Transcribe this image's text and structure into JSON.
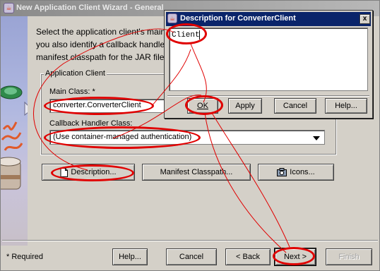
{
  "wizard": {
    "title": "New Application Client Wizard - General",
    "intro_lines": [
      "Select the application client's main",
      "you also identify a callback handler",
      "manifest classpath for the JAR file"
    ],
    "group": {
      "legend": "Application Client",
      "main_class_label": "Main Class: *",
      "main_class_value": "converter.ConverterClient",
      "callback_label": "Callback Handler Class:",
      "callback_value": "(Use container-managed authentication)"
    },
    "buttons": {
      "description": "Description...",
      "manifest_classpath": "Manifest Classpath...",
      "icons": "Icons..."
    },
    "required_note": "* Required",
    "nav": {
      "help": "Help...",
      "cancel": "Cancel",
      "back": "< Back",
      "next": "Next >",
      "finish": "Finish"
    }
  },
  "dialog": {
    "title": "Description for ConverterClient",
    "close_glyph": "x",
    "description_value": "Client",
    "buttons": {
      "ok": "OK",
      "apply": "Apply",
      "cancel": "Cancel",
      "help": "Help..."
    }
  },
  "colors": {
    "window_face": "#d4d0c8",
    "dialog_titlebar": "#0a246a",
    "inactive_titlebar": "#9a9a9a",
    "annotation_red": "#e00000"
  },
  "icons": {
    "app": "java-app-icon",
    "description_button": "document-icon",
    "icons_button": "camera-icon",
    "combo_arrow": "triangle-down-icon"
  }
}
